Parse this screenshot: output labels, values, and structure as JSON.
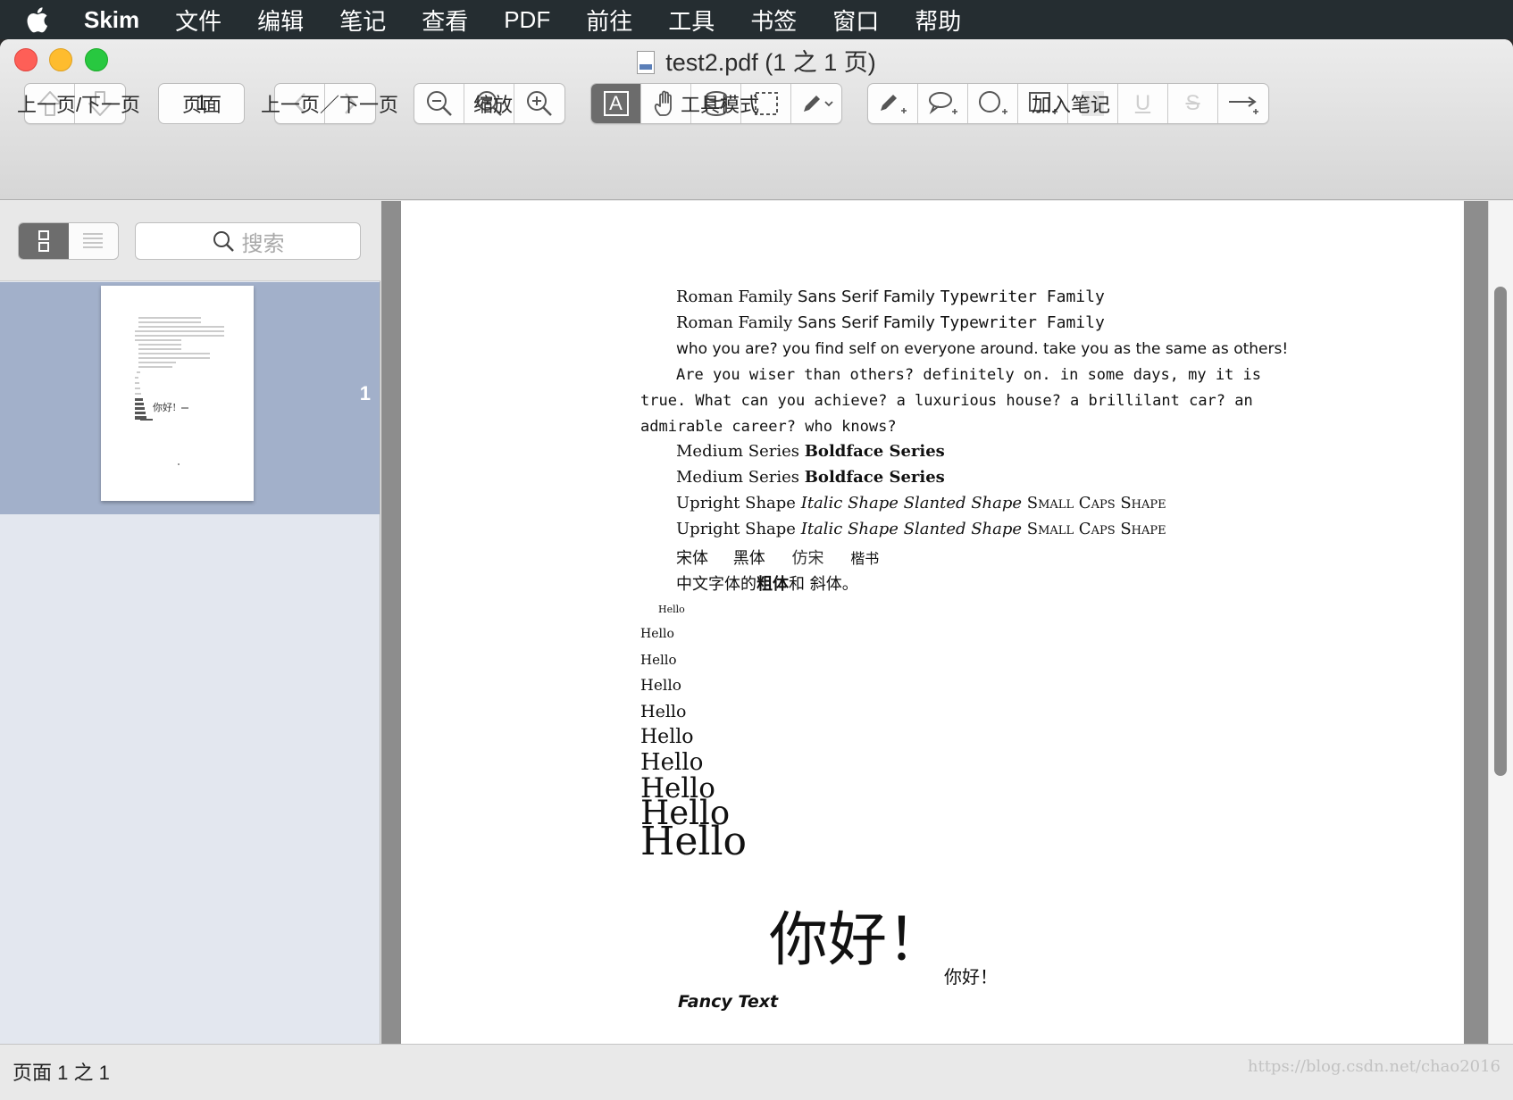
{
  "menubar": {
    "app_name": "Skim",
    "items": [
      "文件",
      "编辑",
      "笔记",
      "查看",
      "PDF",
      "前往",
      "工具",
      "书签",
      "窗口",
      "帮助"
    ]
  },
  "window": {
    "title": "test2.pdf (1 之 1 页)"
  },
  "toolbar": {
    "prev_next_label": "上一页/下一页",
    "page_label": "页面",
    "page_number": "1",
    "history_label": "上一页／下一页",
    "zoom_label": "缩放",
    "tool_mode_label": "工具模式",
    "add_note_label": "加入笔记",
    "tool_mode_letter": "A",
    "highlight_letter": "H",
    "underline_letter": "U",
    "strike_letter": "S"
  },
  "sidebar": {
    "search_placeholder": "搜索",
    "thumbnail_number": "1",
    "thumbnail_text": "你好!"
  },
  "pdf": {
    "line1": {
      "roman": "Roman Family",
      "sans": "Sans Serif Family",
      "tt": "Typewriter Family"
    },
    "line2": {
      "roman": "Roman Family",
      "sans": "Sans Serif Family",
      "tt": "Typewriter Family"
    },
    "sans_para": "who you are? you find self on everyone around. take you as the same as others!",
    "tt_para": [
      "Are you wiser than others? definitely on. in some days, my it is",
      "true. What can you achieve? a luxurious house? a brillilant car? an",
      "admirable career? who knows?"
    ],
    "series1": {
      "medium": "Medium Series",
      "bold": "Boldface Series"
    },
    "series2": {
      "medium": "Medium Series",
      "bold": "Boldface Series"
    },
    "shape1": {
      "upright": "Upright Shape",
      "italic": "Italic Shape",
      "slanted": "Slanted Shape",
      "smallcaps": "Small Caps Shape"
    },
    "shape2": {
      "upright": "Upright Shape",
      "italic": "Italic Shape",
      "slanted": "Slanted Shape",
      "smallcaps": "Small Caps Shape"
    },
    "cjk_fonts": {
      "song": "宋体",
      "hei": "黑体",
      "fangsong": "仿宋",
      "kai": "楷书"
    },
    "cjk_sentence": {
      "a": "中文字体的",
      "b": "粗体",
      "c": "和",
      "d": "斜体。"
    },
    "hellos": [
      "Hello",
      "Hello",
      "Hello",
      "Hello",
      "Hello",
      "Hello",
      "Hello",
      "Hello",
      "Hello",
      "Hello"
    ],
    "big_nihao": "你好！",
    "small_nihao": "你好！",
    "fancy_text": "Fancy Text"
  },
  "status": {
    "text": "页面 1 之 1",
    "watermark": "https://blog.csdn.net/chao2016"
  }
}
